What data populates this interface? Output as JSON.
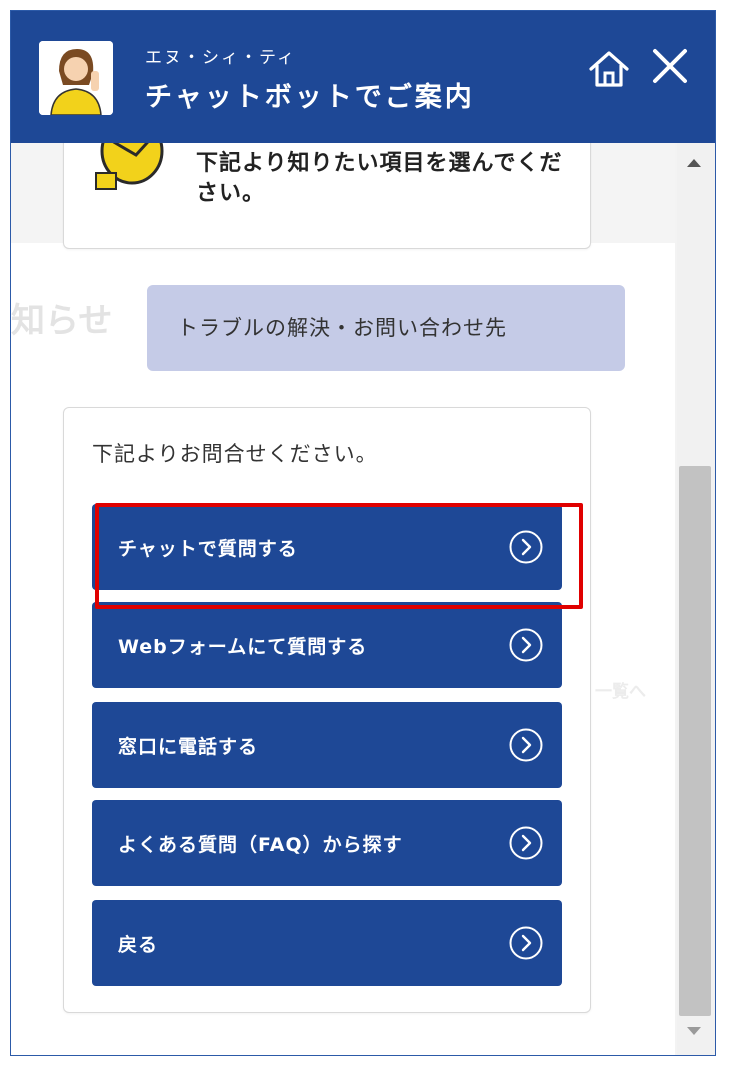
{
  "header": {
    "subtitle": "エヌ・シィ・ティ",
    "title": "チャットボットでご案内",
    "home_icon": "home-icon",
    "close_icon": "close-icon"
  },
  "background": {
    "news_heading": "知らせ",
    "list_link": "一覧へ"
  },
  "messages": {
    "intro_text": "下記より知りたい項目を選んでください。",
    "user_selection": "トラブルの解決・お問い合わせ先",
    "prompt": "下記よりお問合せください。"
  },
  "options": [
    {
      "label": "チャットで質問する",
      "icon": "chevron-right-circle-icon"
    },
    {
      "label": "Webフォームにて質問する",
      "icon": "chevron-right-circle-icon"
    },
    {
      "label": "窓口に電話する",
      "icon": "chevron-right-circle-icon"
    },
    {
      "label": "よくある質問（FAQ）から探す",
      "icon": "chevron-right-circle-icon"
    },
    {
      "label": "戻る",
      "icon": "chevron-right-circle-icon"
    }
  ],
  "colors": {
    "brand": "#1e4896",
    "user_bubble": "#c5cbe7",
    "highlight": "#e00000"
  }
}
